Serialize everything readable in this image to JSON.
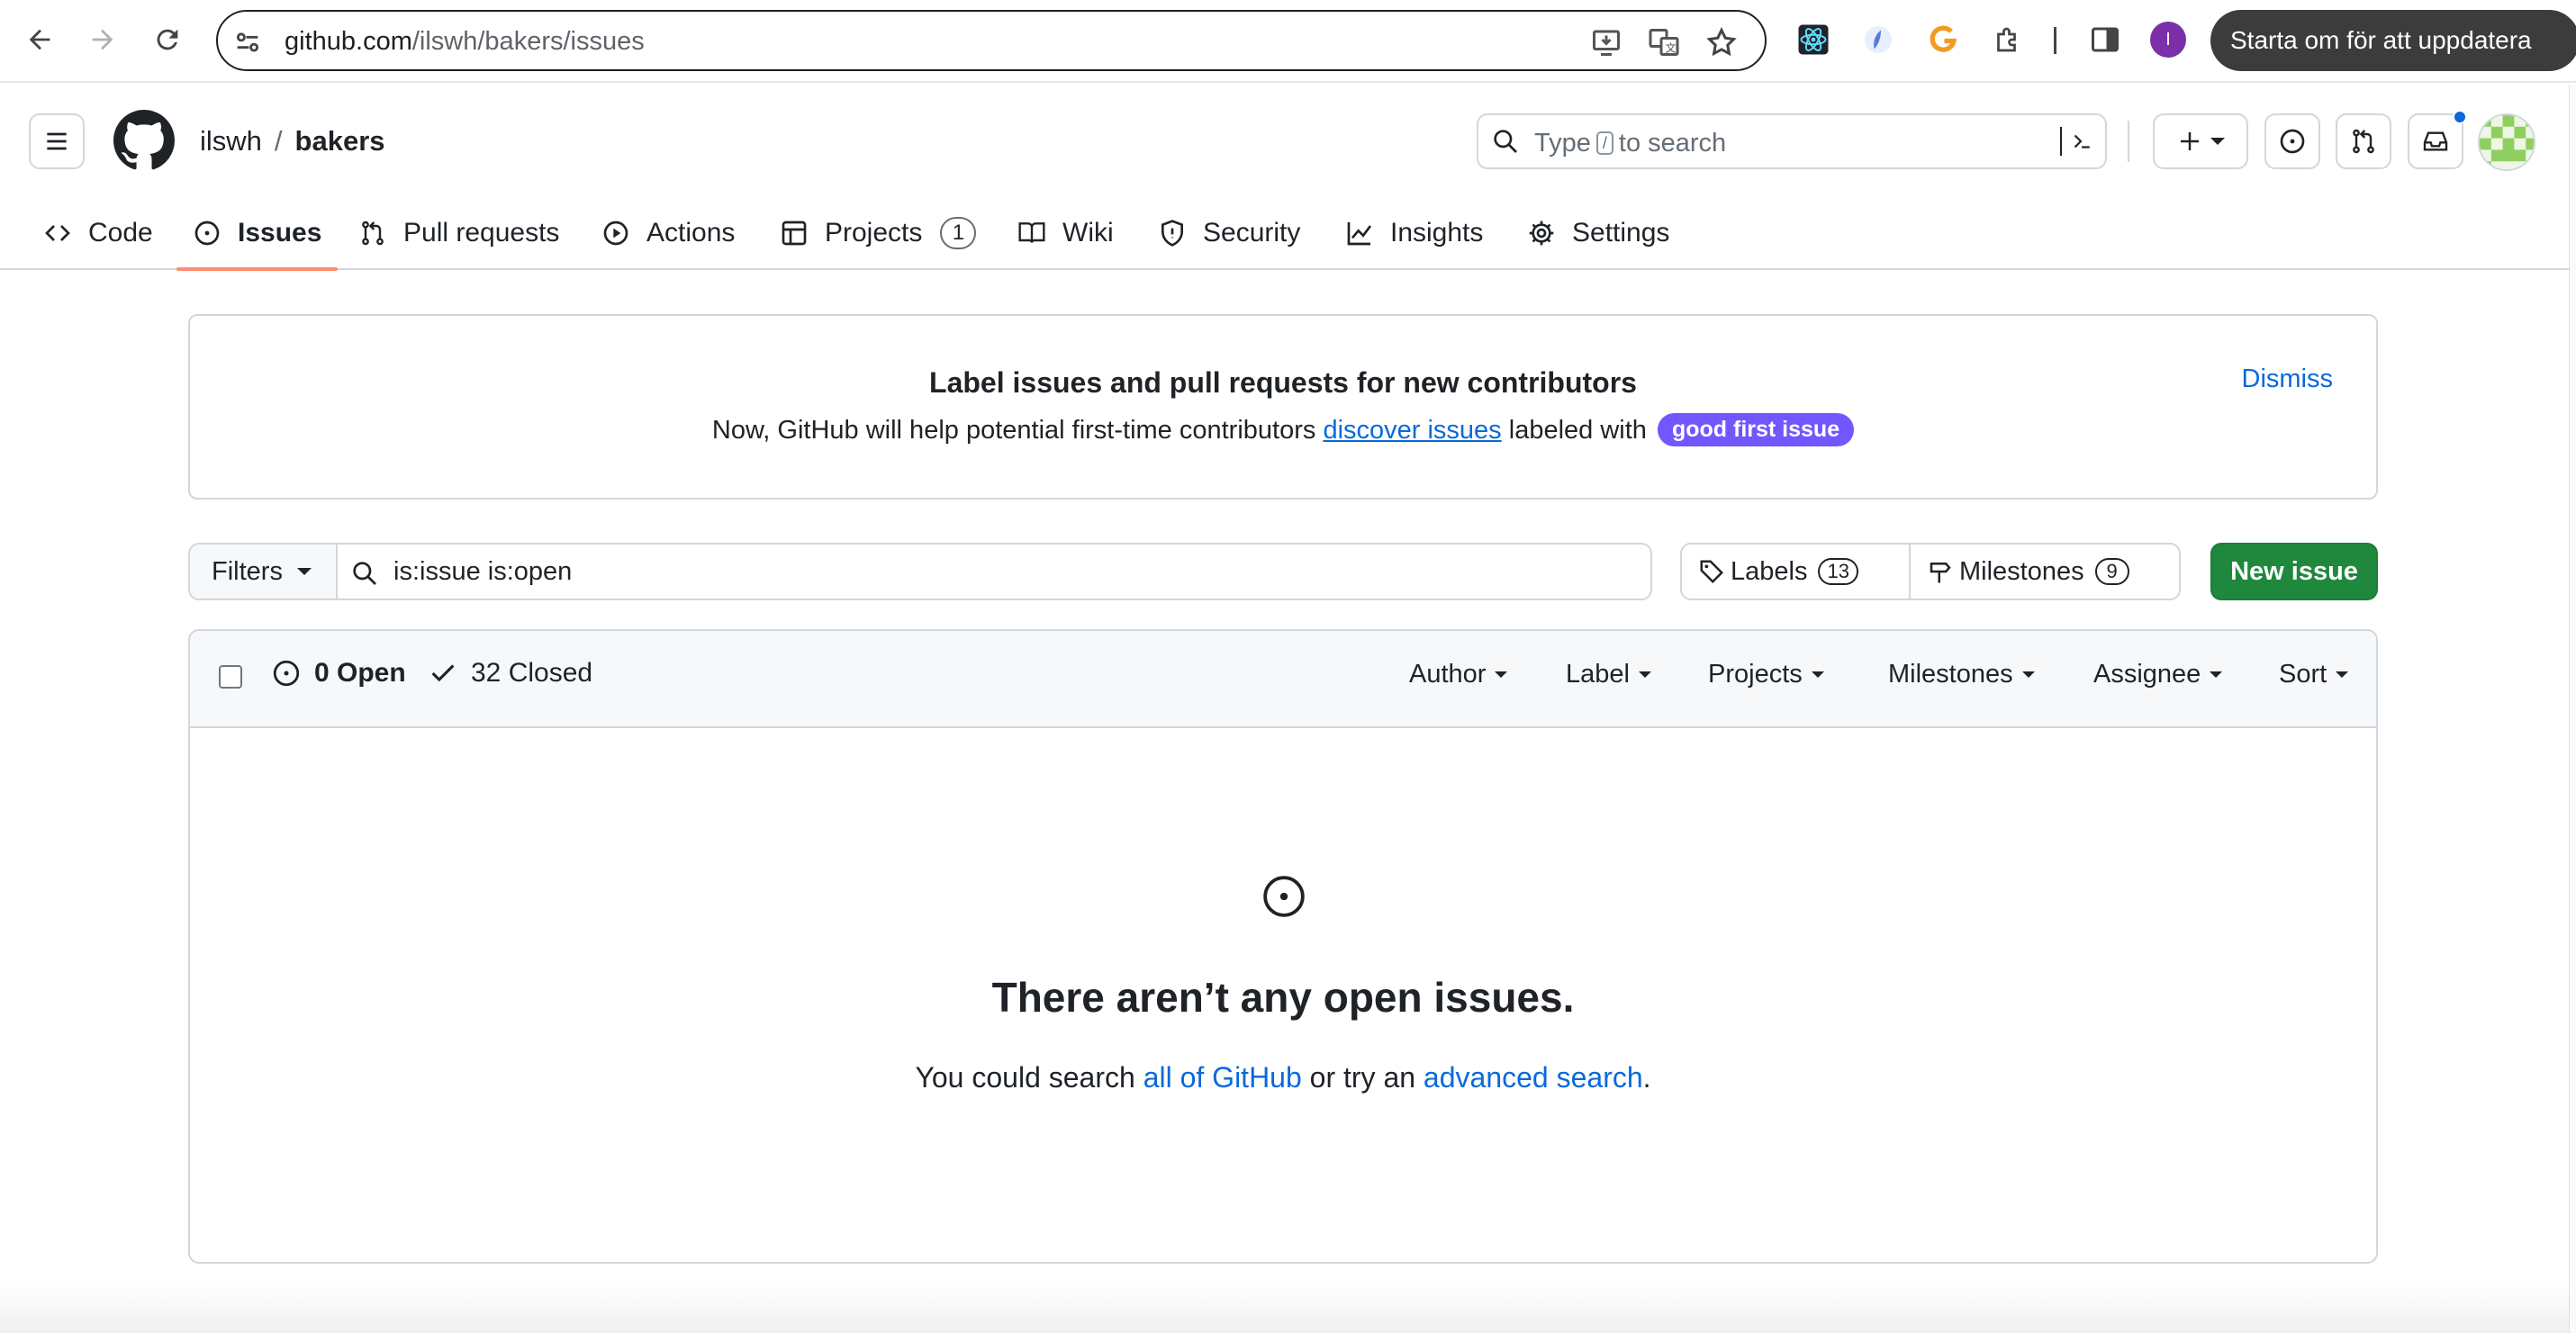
{
  "browser": {
    "url_host": "github.com",
    "url_path": "/ilswh/bakers/issues",
    "profile_initial": "I",
    "update_button": "Starta om för att uppdatera"
  },
  "header": {
    "owner": "ilswh",
    "separator": "/",
    "repo": "bakers",
    "search_prefix": "Type",
    "search_key": "/",
    "search_suffix": "to search"
  },
  "tabs": [
    {
      "label": "Code",
      "icon": "code-icon"
    },
    {
      "label": "Issues",
      "icon": "issue-opened-icon",
      "active": true
    },
    {
      "label": "Pull requests",
      "icon": "git-pull-request-icon"
    },
    {
      "label": "Actions",
      "icon": "play-icon"
    },
    {
      "label": "Projects",
      "icon": "table-icon",
      "count": "1"
    },
    {
      "label": "Wiki",
      "icon": "book-icon"
    },
    {
      "label": "Security",
      "icon": "shield-icon"
    },
    {
      "label": "Insights",
      "icon": "graph-icon"
    },
    {
      "label": "Settings",
      "icon": "gear-icon"
    }
  ],
  "banner": {
    "title": "Label issues and pull requests for new contributors",
    "text_before": "Now, GitHub will help potential first-time contributors",
    "link": "discover issues",
    "text_after": "labeled with",
    "label": "good first issue",
    "label_color": "#7057ff",
    "dismiss": "Dismiss"
  },
  "filters": {
    "button": "Filters",
    "query": "is:issue is:open",
    "labels": "Labels",
    "labels_count": "13",
    "milestones": "Milestones",
    "milestones_count": "9",
    "new_issue": "New issue"
  },
  "issues": {
    "open": "0 Open",
    "closed": "32 Closed",
    "sorters": [
      "Author",
      "Label",
      "Projects",
      "Milestones",
      "Assignee",
      "Sort"
    ],
    "blank_title": "There aren’t any open issues.",
    "blank_before": "You could search",
    "blank_link1": "all of GitHub",
    "blank_mid": "or try an",
    "blank_link2": "advanced search",
    "blank_end": "."
  },
  "colors": {
    "accent": "#0969da",
    "primary_button": "#1f883d",
    "tab_underline": "#fd8c73"
  }
}
